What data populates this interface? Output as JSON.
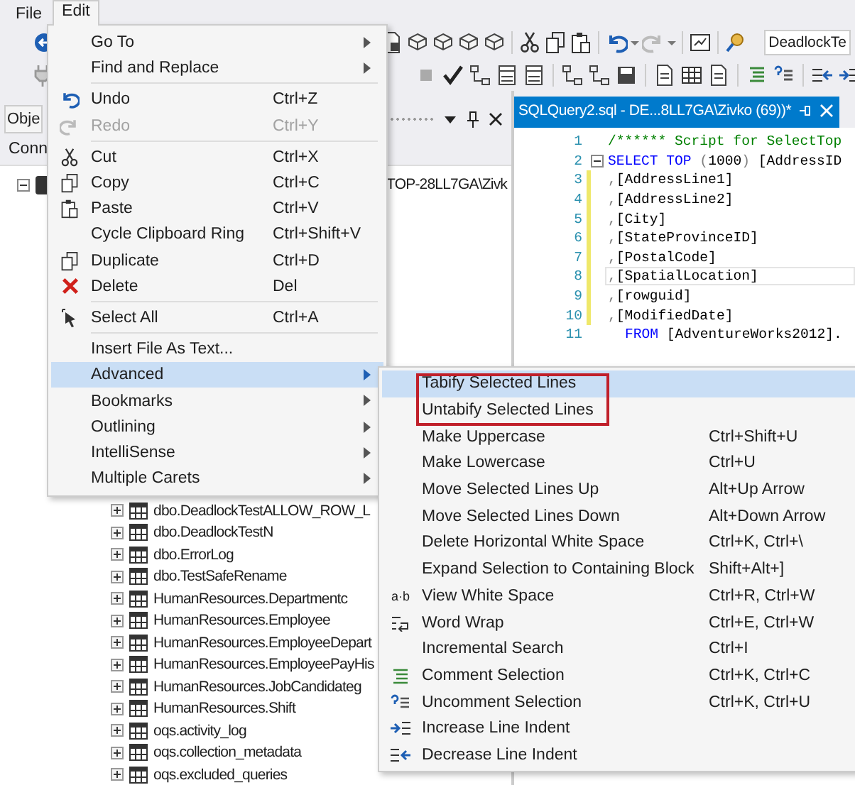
{
  "menubar": [
    {
      "label": "File",
      "selected": false
    },
    {
      "label": "Edit",
      "selected": true
    }
  ],
  "toolbar": {
    "database": "DeadlockTe"
  },
  "object_explorer": {
    "title": "Obje",
    "connect": "Conn",
    "server": "TOP-28LL7GA\\Zivk",
    "tables": [
      {
        "label": "dbo.DeadlockTestALLOW_ROW_L"
      },
      {
        "label": "dbo.DeadlockTestN"
      },
      {
        "label": "dbo.ErrorLog"
      },
      {
        "label": "dbo.TestSafeRename"
      },
      {
        "label": "HumanResources.Departmentc"
      },
      {
        "label": "HumanResources.Employee"
      },
      {
        "label": "HumanResources.EmployeeDepart"
      },
      {
        "label": "HumanResources.EmployeePayHis"
      },
      {
        "label": "HumanResources.JobCandidateg"
      },
      {
        "label": "HumanResources.Shift"
      },
      {
        "label": "oqs.activity_log"
      },
      {
        "label": "oqs.collection_metadata"
      },
      {
        "label": "oqs.excluded_queries"
      }
    ]
  },
  "editor": {
    "tab": "SQLQuery2.sql - DE...8LL7GA\\Zivko (69))*",
    "lines": [
      {
        "number": "1",
        "changed": false,
        "fold": false,
        "current": false,
        "tokens": [
          {
            "kind": "comment",
            "text": "/****** Script for SelectTop"
          }
        ]
      },
      {
        "number": "2",
        "changed": false,
        "fold": true,
        "current": false,
        "tokens": [
          {
            "kind": "keyword",
            "text": "SELECT TOP "
          },
          {
            "kind": "operator",
            "text": "("
          },
          {
            "kind": "plain",
            "text": "1000"
          },
          {
            "kind": "operator",
            "text": ")"
          },
          {
            "kind": "plain",
            "text": " [AddressID"
          }
        ]
      },
      {
        "number": "3",
        "changed": true,
        "fold": false,
        "current": false,
        "tokens": [
          {
            "kind": "operator",
            "text": ","
          },
          {
            "kind": "plain",
            "text": "[AddressLine1]"
          }
        ]
      },
      {
        "number": "4",
        "changed": true,
        "fold": false,
        "current": false,
        "tokens": [
          {
            "kind": "operator",
            "text": ","
          },
          {
            "kind": "plain",
            "text": "[AddressLine2]"
          }
        ]
      },
      {
        "number": "5",
        "changed": true,
        "fold": false,
        "current": false,
        "tokens": [
          {
            "kind": "operator",
            "text": ","
          },
          {
            "kind": "plain",
            "text": "[City]"
          }
        ]
      },
      {
        "number": "6",
        "changed": true,
        "fold": false,
        "current": false,
        "tokens": [
          {
            "kind": "operator",
            "text": ","
          },
          {
            "kind": "plain",
            "text": "[StateProvinceID]"
          }
        ]
      },
      {
        "number": "7",
        "changed": true,
        "fold": false,
        "current": false,
        "tokens": [
          {
            "kind": "operator",
            "text": ","
          },
          {
            "kind": "plain",
            "text": "[PostalCode]"
          }
        ]
      },
      {
        "number": "8",
        "changed": true,
        "fold": false,
        "current": true,
        "tokens": [
          {
            "kind": "operator",
            "text": ","
          },
          {
            "kind": "plain",
            "text": "[SpatialLocation]"
          }
        ]
      },
      {
        "number": "9",
        "changed": true,
        "fold": false,
        "current": false,
        "tokens": [
          {
            "kind": "operator",
            "text": ","
          },
          {
            "kind": "plain",
            "text": "[rowguid]"
          }
        ]
      },
      {
        "number": "10",
        "changed": true,
        "fold": false,
        "current": false,
        "tokens": [
          {
            "kind": "operator",
            "text": ","
          },
          {
            "kind": "plain",
            "text": "[ModifiedDate]"
          }
        ]
      },
      {
        "number": "11",
        "changed": false,
        "fold": false,
        "current": false,
        "indented": true,
        "tokens": [
          {
            "kind": "keyword",
            "text": "FROM"
          },
          {
            "kind": "plain",
            "text": " [AdventureWorks2012]."
          }
        ]
      }
    ]
  },
  "edit_menu": [
    {
      "kind": "item",
      "label": "Go To",
      "submenu": true,
      "disabled": false,
      "selected": false
    },
    {
      "kind": "item",
      "label": "Find and Replace",
      "submenu": true,
      "disabled": false,
      "selected": false
    },
    {
      "kind": "separator"
    },
    {
      "kind": "item",
      "label": "Undo",
      "shortcut": "Ctrl+Z",
      "disabled": false,
      "selected": false
    },
    {
      "kind": "item",
      "label": "Redo",
      "shortcut": "Ctrl+Y",
      "disabled": true,
      "selected": false
    },
    {
      "kind": "separator"
    },
    {
      "kind": "item",
      "label": "Cut",
      "shortcut": "Ctrl+X",
      "disabled": false,
      "selected": false
    },
    {
      "kind": "item",
      "label": "Copy",
      "shortcut": "Ctrl+C",
      "disabled": false,
      "selected": false
    },
    {
      "kind": "item",
      "label": "Paste",
      "shortcut": "Ctrl+V",
      "disabled": false,
      "selected": false
    },
    {
      "kind": "item",
      "label": "Cycle Clipboard Ring",
      "shortcut": "Ctrl+Shift+V",
      "disabled": false,
      "selected": false
    },
    {
      "kind": "item",
      "label": "Duplicate",
      "shortcut": "Ctrl+D",
      "disabled": false,
      "selected": false
    },
    {
      "kind": "item",
      "label": "Delete",
      "shortcut": "Del",
      "disabled": false,
      "selected": false
    },
    {
      "kind": "separator"
    },
    {
      "kind": "item",
      "label": "Select All",
      "shortcut": "Ctrl+A",
      "disabled": false,
      "selected": false
    },
    {
      "kind": "separator"
    },
    {
      "kind": "item",
      "label": "Insert File As Text...",
      "disabled": false,
      "selected": false
    },
    {
      "kind": "item",
      "label": "Advanced",
      "submenu": true,
      "disabled": false,
      "selected": true
    },
    {
      "kind": "item",
      "label": "Bookmarks",
      "submenu": true,
      "disabled": false,
      "selected": false
    },
    {
      "kind": "item",
      "label": "Outlining",
      "submenu": true,
      "disabled": false,
      "selected": false
    },
    {
      "kind": "item",
      "label": "IntelliSense",
      "submenu": true,
      "disabled": false,
      "selected": false
    },
    {
      "kind": "item",
      "label": "Multiple Carets",
      "submenu": true,
      "disabled": false,
      "selected": false
    }
  ],
  "advanced_menu": [
    {
      "label": "Tabify Selected Lines",
      "selected": true,
      "outlined": true
    },
    {
      "label": "Untabify Selected Lines",
      "selected": false,
      "outlined": true
    },
    {
      "label": "Make Uppercase",
      "shortcut": "Ctrl+Shift+U",
      "selected": false,
      "outlined": false
    },
    {
      "label": "Make Lowercase",
      "shortcut": "Ctrl+U",
      "selected": false,
      "outlined": false
    },
    {
      "label": "Move Selected Lines Up",
      "shortcut": "Alt+Up Arrow",
      "selected": false,
      "outlined": false
    },
    {
      "label": "Move Selected Lines Down",
      "shortcut": "Alt+Down Arrow",
      "selected": false,
      "outlined": false
    },
    {
      "label": "Delete Horizontal White Space",
      "shortcut": "Ctrl+K, Ctrl+\\",
      "selected": false,
      "outlined": false
    },
    {
      "label": "Expand Selection to Containing Block",
      "shortcut": "Shift+Alt+]",
      "selected": false,
      "outlined": false
    },
    {
      "label": "View White Space",
      "shortcut": "Ctrl+R, Ctrl+W",
      "glyph": "a·b",
      "selected": false,
      "outlined": false
    },
    {
      "label": "Word Wrap",
      "shortcut": "Ctrl+E, Ctrl+W",
      "selected": false,
      "outlined": false
    },
    {
      "label": "Incremental Search",
      "shortcut": "Ctrl+I",
      "selected": false,
      "outlined": false
    },
    {
      "label": "Comment Selection",
      "shortcut": "Ctrl+K, Ctrl+C",
      "selected": false,
      "outlined": false
    },
    {
      "label": "Uncomment Selection",
      "shortcut": "Ctrl+K, Ctrl+U",
      "selected": false,
      "outlined": false
    },
    {
      "label": "Increase Line Indent",
      "selected": false,
      "outlined": false
    },
    {
      "label": "Decrease Line Indent",
      "selected": false,
      "outlined": false
    }
  ]
}
